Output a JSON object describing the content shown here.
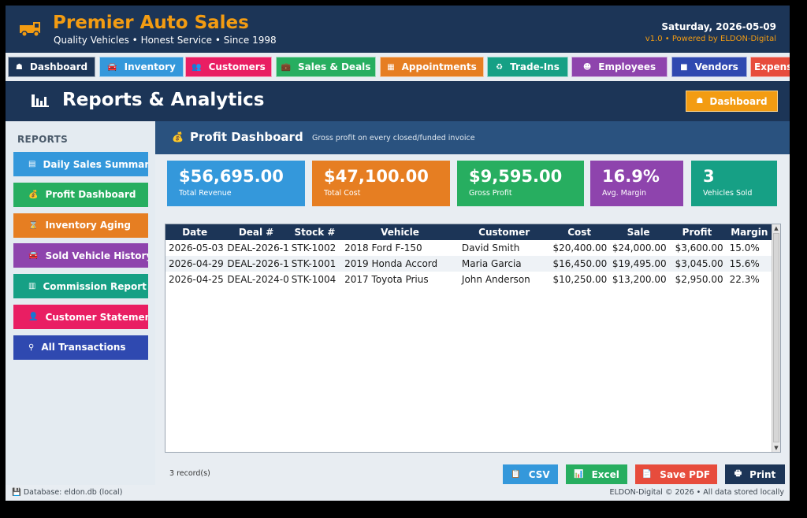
{
  "header": {
    "title": "Premier Auto Sales",
    "tagline": "Quality Vehicles  •  Honest Service  •  Since 1998",
    "date": "Saturday, 2026-05-09",
    "version": "v1.0  •  Powered by ELDON-Digital",
    "logo_icon": "truck-icon"
  },
  "nav": [
    {
      "label": "Dashboard",
      "icon": "home-icon",
      "glyph": "☗",
      "color": "#1c3557"
    },
    {
      "label": "Inventory",
      "icon": "car-icon",
      "glyph": "🚘",
      "color": "#3498db"
    },
    {
      "label": "Customers",
      "icon": "users-icon",
      "glyph": "👥",
      "color": "#e91e63"
    },
    {
      "label": "Sales & Deals",
      "icon": "briefcase-icon",
      "glyph": "💼",
      "color": "#27ae60"
    },
    {
      "label": "Appointments",
      "icon": "calendar-icon",
      "glyph": "▦",
      "color": "#e67e22"
    },
    {
      "label": "Trade-Ins",
      "icon": "refresh-icon",
      "glyph": "♻",
      "color": "#16a085"
    },
    {
      "label": "Employees",
      "icon": "team-icon",
      "glyph": "☻",
      "color": "#8e44ad"
    },
    {
      "label": "Vendors",
      "icon": "box-icon",
      "glyph": "■",
      "color": "#2f49b0"
    },
    {
      "label": "Expenses",
      "icon": "",
      "glyph": "",
      "color": "#e74c3c"
    }
  ],
  "page": {
    "title": "Reports & Analytics",
    "title_icon": "bar-chart-icon",
    "dashboard_button": "Dashboard"
  },
  "sidebar": {
    "heading": "REPORTS",
    "items": [
      {
        "label": "Daily Sales Summary",
        "icon": "calendar-icon",
        "glyph": "▤",
        "color": "#3498db"
      },
      {
        "label": "Profit Dashboard",
        "icon": "money-bag-icon",
        "glyph": "💰",
        "color": "#27ae60"
      },
      {
        "label": "Inventory Aging",
        "icon": "hourglass-icon",
        "glyph": "⌛",
        "color": "#e67e22"
      },
      {
        "label": "Sold Vehicle History",
        "icon": "car-icon",
        "glyph": "🚘",
        "color": "#8e44ad"
      },
      {
        "label": "Commission Report",
        "icon": "receipt-icon",
        "glyph": "▥",
        "color": "#16a085"
      },
      {
        "label": "Customer Statements",
        "icon": "user-icon",
        "glyph": "👤",
        "color": "#e91e63"
      },
      {
        "label": "All Transactions",
        "icon": "search-icon",
        "glyph": "⚲",
        "color": "#2f49b0"
      }
    ]
  },
  "section": {
    "icon": "money-bag-icon",
    "title": "Profit Dashboard",
    "subtitle": "Gross profit on every closed/funded invoice"
  },
  "kpis": [
    {
      "value": "$56,695.00",
      "label": "Total Revenue",
      "color": "#3498db"
    },
    {
      "value": "$47,100.00",
      "label": "Total Cost",
      "color": "#e67e22"
    },
    {
      "value": "$9,595.00",
      "label": "Gross Profit",
      "color": "#27ae60"
    },
    {
      "value": "16.9%",
      "label": "Avg. Margin",
      "color": "#8e44ad"
    },
    {
      "value": "3",
      "label": "Vehicles Sold",
      "color": "#16a085"
    }
  ],
  "table": {
    "columns": [
      "Date",
      "Deal #",
      "Stock #",
      "Vehicle",
      "Customer",
      "Cost",
      "Sale",
      "Profit",
      "Margin"
    ],
    "rows": [
      [
        "2026-05-03",
        "DEAL-2026-1",
        "STK-1002",
        "2018 Ford F-150",
        "David Smith",
        "$20,400.00",
        "$24,000.00",
        "$3,600.00",
        "15.0%"
      ],
      [
        "2026-04-29",
        "DEAL-2026-1",
        "STK-1001",
        "2019 Honda Accord",
        "Maria Garcia",
        "$16,450.00",
        "$19,495.00",
        "$3,045.00",
        "15.6%"
      ],
      [
        "2026-04-25",
        "DEAL-2024-0",
        "STK-1004",
        "2017 Toyota Prius",
        "John Anderson",
        "$10,250.00",
        "$13,200.00",
        "$2,950.00",
        "22.3%"
      ]
    ]
  },
  "footer": {
    "record_count": "3 record(s)",
    "buttons": [
      {
        "label": "CSV",
        "icon": "clipboard-icon",
        "glyph": "📋",
        "color": "#3498db"
      },
      {
        "label": "Excel",
        "icon": "chart-icon",
        "glyph": "📊",
        "color": "#27ae60"
      },
      {
        "label": "Save PDF",
        "icon": "document-icon",
        "glyph": "📄",
        "color": "#e74c3c"
      },
      {
        "label": "Print",
        "icon": "printer-icon",
        "glyph": "🖶",
        "color": "#1c3557"
      }
    ]
  },
  "status": {
    "database": "💾 Database: eldon.db (local)",
    "copyright": "ELDON-Digital © 2026  •  All data stored locally"
  }
}
